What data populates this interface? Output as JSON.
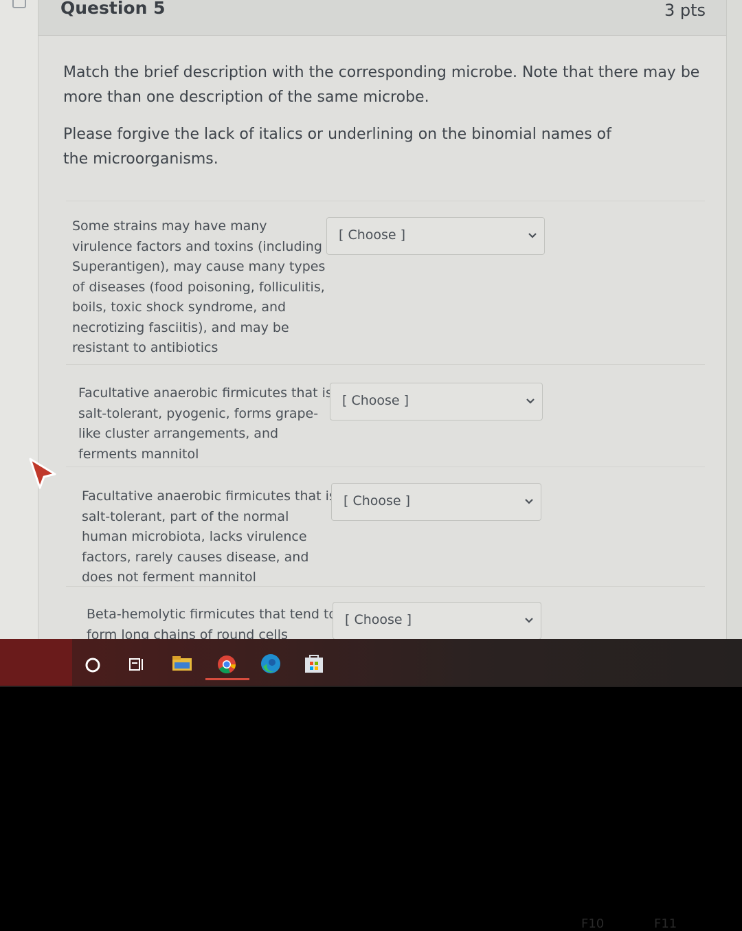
{
  "question": {
    "title": "Question 5",
    "points": "3 pts",
    "instructions": [
      "Match the brief description with the corresponding microbe.  Note that there may be more than one description of the same microbe.",
      "Please forgive the lack of italics or underlining on the binomial names of the microorganisms."
    ],
    "matches": [
      {
        "prompt": "Some strains may have many virulence factors and toxins (including Superantigen), may cause many types of diseases (food poisoning, folliculitis, boils, toxic shock syndrome, and necrotizing fasciitis), and may be resistant to antibiotics",
        "selected": "[ Choose ]"
      },
      {
        "prompt": "Facultative anaerobic firmicutes that is salt-tolerant, pyogenic, forms grape-like cluster arrangements, and ferments mannitol",
        "selected": "[ Choose ]"
      },
      {
        "prompt": "Facultative anaerobic firmicutes that is salt-tolerant, part of the normal human microbiota, lacks virulence factors, rarely causes disease, and does not ferment mannitol",
        "selected": "[ Choose ]"
      },
      {
        "prompt": "Beta-hemolytic firmicutes that tend to form long chains of round cells",
        "selected": "[ Choose ]"
      }
    ]
  },
  "taskbar": {
    "icons": [
      "search-circle-icon",
      "task-view-icon",
      "file-explorer-icon",
      "chrome-icon",
      "edge-icon",
      "store-icon"
    ]
  },
  "keyboard": {
    "function_keys": [
      "F10",
      "F11"
    ]
  },
  "colors": {
    "page_background": "#dadbd7",
    "text": "#3e444b",
    "taskbar": "#24201f",
    "taskbar_active": "#d64c3e"
  }
}
